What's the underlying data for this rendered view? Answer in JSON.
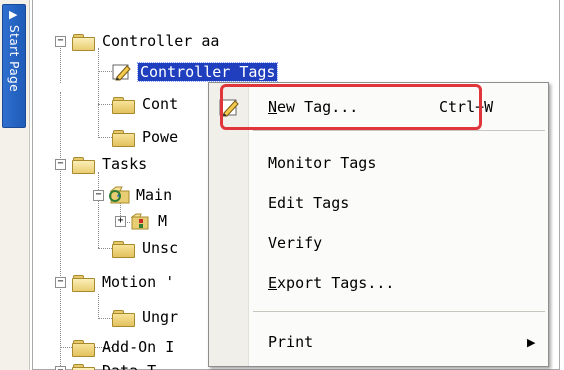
{
  "sidebar": {
    "start_tab_label": "Start Page",
    "collapse_arrow": "▶"
  },
  "tree": {
    "controller": {
      "expander": "−",
      "label": "Controller aa"
    },
    "controller_tags": {
      "label": "Controller Tags"
    },
    "controller_fault": {
      "label": "Cont"
    },
    "power_up": {
      "label": "Powe"
    },
    "tasks": {
      "expander": "−",
      "label": "Tasks"
    },
    "main_task": {
      "expander": "−",
      "label": "Main"
    },
    "main_program": {
      "expander": "+",
      "label": "M"
    },
    "unscheduled": {
      "label": "Unsc"
    },
    "motion": {
      "expander": "−",
      "label": "Motion '"
    },
    "ungrouped": {
      "label": "Ungr"
    },
    "addon": {
      "label": "Add-On I"
    },
    "data_types": {
      "expander": "−",
      "label": "Data T"
    }
  },
  "context_menu": {
    "new_tag": {
      "label_u": "N",
      "label_rest": "ew Tag...",
      "shortcut": "Ctrl+W"
    },
    "monitor_tags": {
      "label": "Monitor Tags"
    },
    "edit_tags": {
      "label": "Edit Tags"
    },
    "verify": {
      "label": "Verify"
    },
    "export_tags": {
      "label_u": "E",
      "label_rest": "xport Tags..."
    },
    "print": {
      "label": "Print",
      "submenu_arrow": "▶"
    }
  },
  "colors": {
    "selection": "#1f3fbf",
    "highlight_annotation": "#e0363b",
    "start_tab": "#2f6fcf"
  }
}
